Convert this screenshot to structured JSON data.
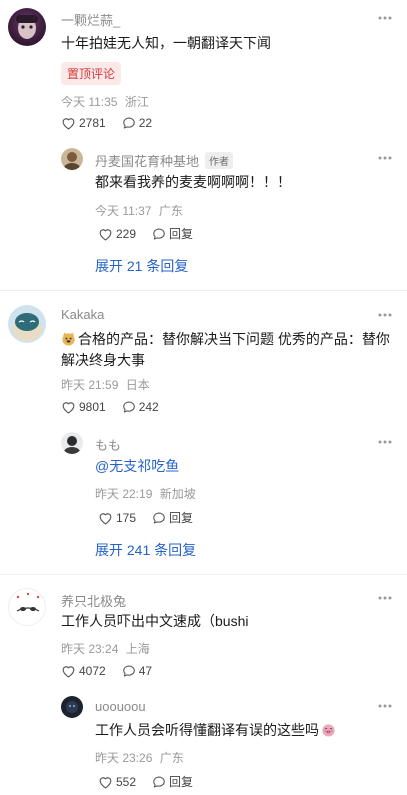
{
  "comments": [
    {
      "user": "一颗烂蒜_",
      "text": "十年拍娃无人知，一朝翻译天下闻",
      "pinned_label": "置顶评论",
      "time": "今天 11:35",
      "location": "浙江",
      "likes": "2781",
      "replies_count": "22",
      "reply": {
        "user": "丹麦国花育种基地",
        "author_badge": "作者",
        "text": "都来看我养的麦麦啊啊啊！！！",
        "time": "今天 11:37",
        "location": "广东",
        "likes": "229",
        "reply_label": "回复"
      },
      "expand_label": "展开 21 条回复"
    },
    {
      "user": "Kakaka",
      "text": "合格的产品：替你解决当下问题 优秀的产品：替你解决终身大事",
      "text_line1": "合格的产品：替你解决当下问题 优秀的产品：替你",
      "text_line2": "解决终身大事",
      "time": "昨天 21:59",
      "location": "日本",
      "likes": "9801",
      "replies_count": "242",
      "reply": {
        "user": "もも",
        "text": "@无支祁吃鱼",
        "time": "昨天 22:19",
        "location": "新加坡",
        "likes": "175",
        "reply_label": "回复"
      },
      "expand_label": "展开 241 条回复"
    },
    {
      "user": "养只北极兔",
      "text": "工作人员吓出中文速成（bushi",
      "time": "昨天 23:24",
      "location": "上海",
      "likes": "4072",
      "replies_count": "47",
      "reply": {
        "user": "uoouoou",
        "text": "工作人员会听得懂翻译有误的这些吗",
        "time": "昨天 23:26",
        "location": "广东",
        "likes": "552",
        "reply_label": "回复"
      }
    }
  ],
  "icons": {
    "like": "heart-outline-icon",
    "comment": "speech-bubble-icon",
    "more": "more-dots-icon"
  },
  "colors": {
    "link": "#2563c9",
    "pinned": "#d33a3a",
    "meta": "#9a9a9a"
  }
}
